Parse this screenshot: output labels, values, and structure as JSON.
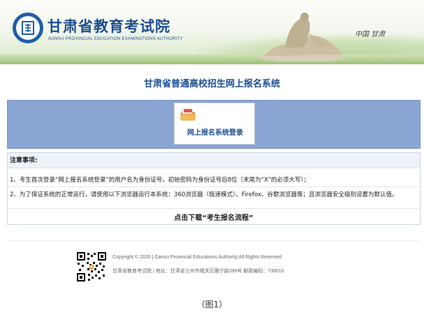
{
  "header": {
    "title": "甘肃省教育考试院",
    "subtitle": "GANSU PROVINCIAL EDUCATION EXAMINATIONS AUTHORITY",
    "region": "中国  甘肃"
  },
  "main": {
    "system_title": "甘肃省普通高校招生网上报名系统",
    "login_label": "网上报名系统登录"
  },
  "notice": {
    "heading": "注意事项:",
    "items": [
      "1、考生首次登录“网上报名系统登录”的用户名为身份证号，初始密码为身份证号后8位（末尾为“X”的必须大写）；",
      "2、为了保证系统的正常运行，请使用以下浏览器运行本系统：360浏览器（极速模式）、Firefox、谷歌浏览器等；且浏览器安全级别设置为默认值。"
    ],
    "download_label": "点击下载“考生报名流程”"
  },
  "footer": {
    "copyright": "Copyright © 2020 | Gansu Provincial Educations Authority All Rights Reserved",
    "info": "甘肃省教育考试院 | 地址：甘肃省兰州市城关区雁宁路399号 邮政编码：730010"
  },
  "caption": "（图1）",
  "colors": {
    "brand_blue": "#1d4e8f",
    "login_band": "#8aa5d3"
  }
}
